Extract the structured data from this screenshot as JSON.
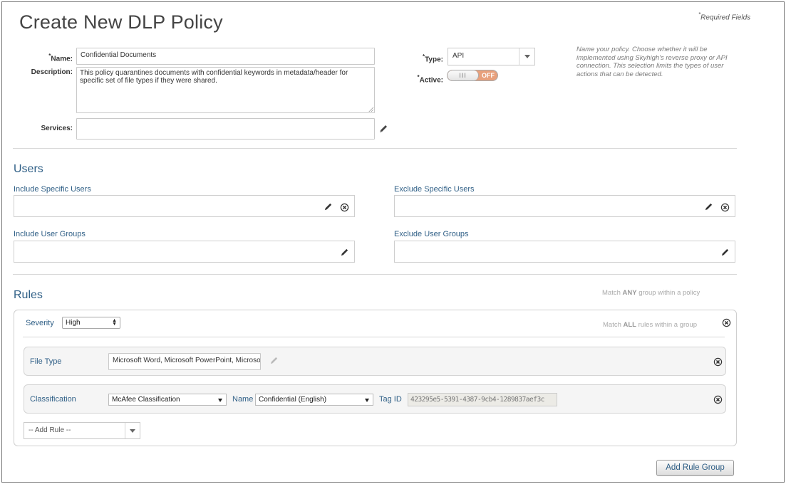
{
  "page": {
    "title": "Create New DLP Policy",
    "required_note": "Required Fields",
    "required_star": "*"
  },
  "form": {
    "name_label": "Name:",
    "name_value": "Confidential Documents",
    "description_label": "Description:",
    "description_value": "This policy quarantines documents with confidential keywords in metadata/header for specific set of file types if they were shared.",
    "services_label": "Services:",
    "services_value": "",
    "type_label": "Type:",
    "type_value": "API",
    "active_label": "Active:",
    "active_knob": "III",
    "active_state": "OFF",
    "help_text": "Name your policy. Choose whether it will be implemented using Skyhigh's reverse proxy or API connection. This selection limits the types of user actions that can be detected."
  },
  "users": {
    "title": "Users",
    "include_specific_label": "Include Specific Users",
    "exclude_specific_label": "Exclude Specific Users",
    "include_groups_label": "Include User Groups",
    "exclude_groups_label": "Exclude User Groups"
  },
  "rules": {
    "title": "Rules",
    "match_any_prefix": "Match ",
    "match_any_bold": "ANY",
    "match_any_suffix": " group within a policy",
    "match_all_prefix": "Match ",
    "match_all_bold": "ALL",
    "match_all_suffix": " rules within a group",
    "severity_label": "Severity",
    "severity_value": "High",
    "file_type": {
      "label": "File Type",
      "value": "Microsoft Word, Microsoft PowerPoint, Microsoft"
    },
    "classification": {
      "label": "Classification",
      "classifier_value": "McAfee Classification",
      "name_label": "Name",
      "name_value": "Confidential (English)",
      "tag_label": "Tag ID",
      "tag_value": "423295e5-5391-4387-9cb4-1289837aef3c"
    },
    "add_rule": "-- Add Rule --",
    "add_rule_group": "Add Rule Group"
  },
  "colors": {
    "accent": "#2f5f86",
    "toggle_off": "#e8a07c"
  }
}
